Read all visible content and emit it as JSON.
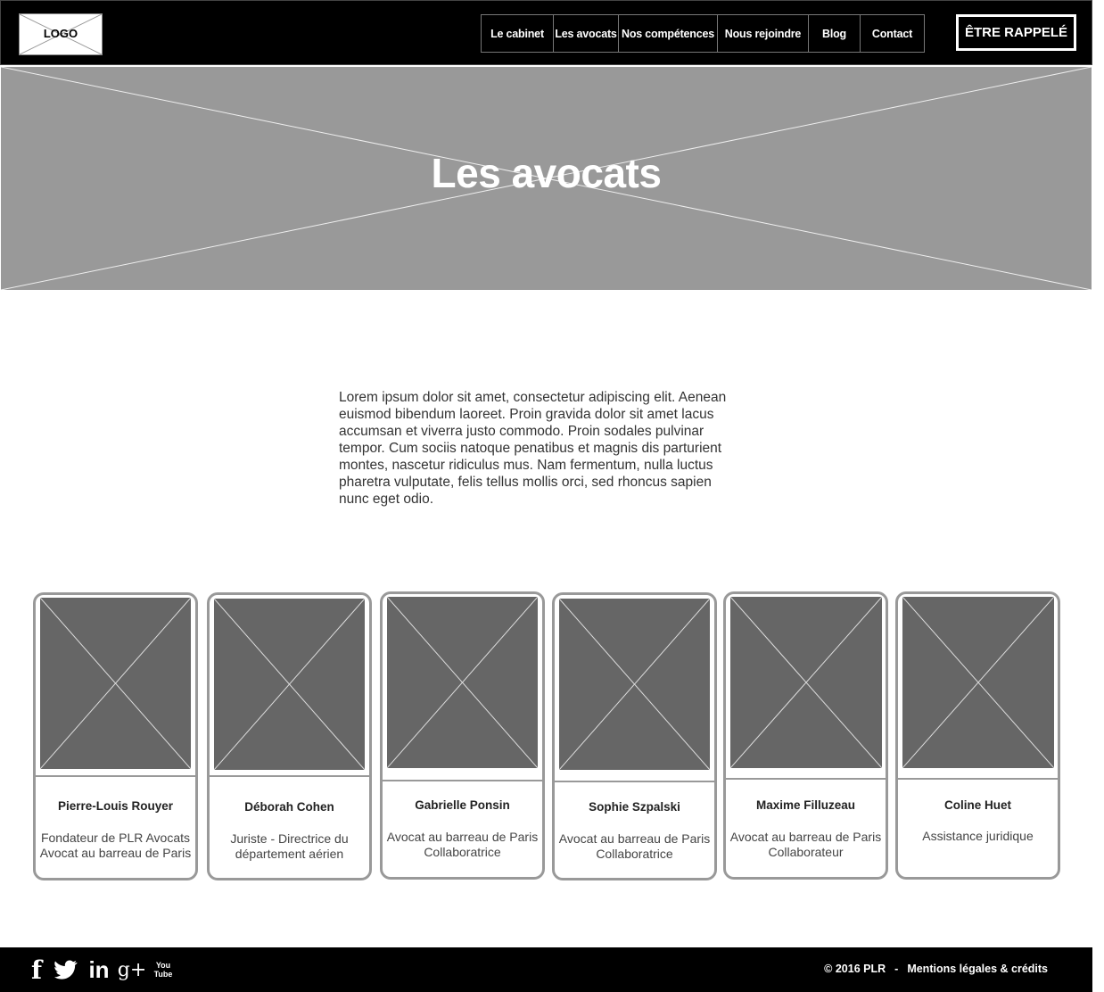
{
  "header": {
    "logo_text": "LOGO",
    "nav": [
      {
        "label": "Le cabinet"
      },
      {
        "label": "Les avocats"
      },
      {
        "label": "Nos compétences"
      },
      {
        "label": "Nous rejoindre"
      },
      {
        "label": "Blog"
      },
      {
        "label": "Contact"
      }
    ],
    "cta_label": "ÊTRE RAPPELÉ"
  },
  "hero": {
    "title": "Les avocats"
  },
  "intro": {
    "text": "Lorem ipsum dolor sit amet, consectetur adipiscing elit. Aenean euismod bibendum laoreet. Proin gravida dolor sit amet lacus accumsan et viverra justo commodo. Proin sodales pulvinar tempor. Cum sociis natoque penatibus et magnis dis parturient montes, nascetur ridiculus mus. Nam fermentum, nulla luctus pharetra vulputate, felis tellus mollis orci, sed rhoncus sapien nunc eget odio."
  },
  "team": [
    {
      "name": "Pierre-Louis Rouyer",
      "role_line1": "Fondateur de PLR Avocats",
      "role_line2": "Avocat au barreau de Paris"
    },
    {
      "name": "Déborah Cohen",
      "role_line1": "Juriste - Directrice du",
      "role_line2": "département aérien"
    },
    {
      "name": "Gabrielle Ponsin",
      "role_line1": "Avocat au barreau de Paris",
      "role_line2": "Collaboratrice"
    },
    {
      "name": "Sophie Szpalski",
      "role_line1": "Avocat au barreau de Paris",
      "role_line2": "Collaboratrice"
    },
    {
      "name": "Maxime Filluzeau",
      "role_line1": "Avocat au barreau de Paris",
      "role_line2": "Collaborateur"
    },
    {
      "name": "Coline Huet",
      "role_line1": "Assistance juridique",
      "role_line2": ""
    }
  ],
  "footer": {
    "social": [
      {
        "icon": "facebook-icon",
        "glyph": "f"
      },
      {
        "icon": "twitter-icon",
        "glyph": "🐦"
      },
      {
        "icon": "linkedin-icon",
        "glyph": "in"
      },
      {
        "icon": "google-plus-icon",
        "glyph": "g+"
      },
      {
        "icon": "youtube-icon",
        "glyph": "You Tube"
      }
    ],
    "copyright": "© 2016 PLR",
    "separator": "-",
    "legal_link": "Mentions légales & crédits"
  }
}
